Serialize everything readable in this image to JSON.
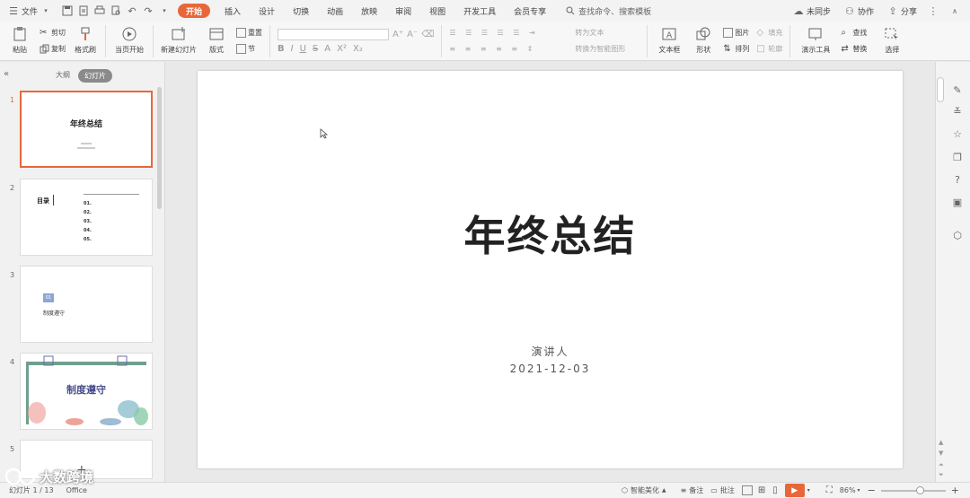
{
  "menubar": {
    "file_label": "文件",
    "tabs": [
      "开始",
      "插入",
      "设计",
      "切换",
      "动画",
      "放映",
      "审阅",
      "视图",
      "开发工具",
      "会员专享"
    ],
    "search_placeholder": "查找命令、搜索模板",
    "sync_label": "未同步",
    "collab_label": "协作",
    "share_label": "分享"
  },
  "ribbon": {
    "paste_label": "粘贴",
    "cut_label": "剪切",
    "copy_label": "复制",
    "format_painter_label": "格式刷",
    "from_current_label": "当页开始",
    "new_slide_label": "新建幻灯片",
    "layout_label": "版式",
    "section_label": "节",
    "reset_label": "重置",
    "font_format_buttons": [
      "B",
      "I",
      "U",
      "S",
      "A",
      "X²",
      "X₂"
    ],
    "text_box_label": "文本框",
    "shape_label": "形状",
    "picture_label": "图片",
    "arrange_label": "排列",
    "fill_label": "填充",
    "outline_label": "轮廓",
    "convert_to_smart_label": "转换为智能图形",
    "text_effect_label": "转为文本",
    "demo_tools_label": "演示工具",
    "find_label": "查找",
    "replace_label": "替换",
    "select_label": "选择"
  },
  "leftpanel": {
    "outline_tab": "大纲",
    "slides_tab": "幻灯片",
    "thumbs": [
      {
        "num": "1",
        "title": "年终总结"
      },
      {
        "num": "2",
        "title": "目录",
        "items": [
          "01.",
          "02.",
          "03.",
          "04.",
          "05."
        ]
      },
      {
        "num": "3",
        "badge": "01",
        "title": "制度遵守"
      },
      {
        "num": "4",
        "title": "制度遵守"
      },
      {
        "num": "5"
      }
    ]
  },
  "slide": {
    "title": "年终总结",
    "presenter": "演讲人",
    "date": "2021-12-03"
  },
  "statusbar": {
    "slide_counter": "幻灯片 1 / 13",
    "theme": "Office",
    "smart_beautify": "智能美化",
    "notes": "备注",
    "comments": "批注",
    "zoom": "86%",
    "zoom_level": 0.6
  },
  "watermark": "大数跨境",
  "colors": {
    "accent": "#e8673a"
  }
}
